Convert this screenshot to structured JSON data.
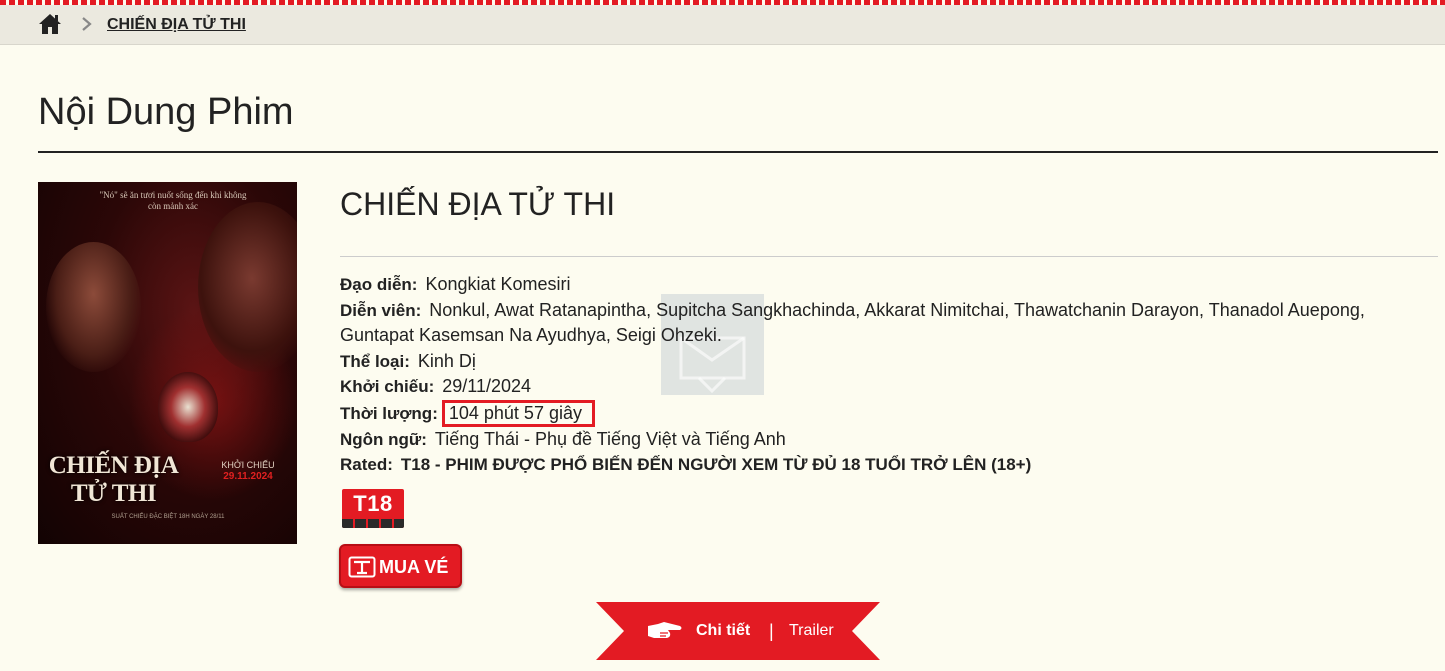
{
  "breadcrumb": {
    "current": "CHIẾN ĐỊA TỬ THI"
  },
  "page": {
    "title": "Nội Dung Phim"
  },
  "poster": {
    "tagline": "\"Nó\" sẽ ăn tươi nuốt sống đến khi không còn mảnh xác",
    "title_line1": "CHIẾN ĐỊA",
    "title_line2": "TỬ THI",
    "release_label": "KHỞI CHIẾU",
    "release_date": "29.11.2024",
    "credits": "SUẤT CHIẾU ĐẶC BIỆT 18H NGÀY 28/11"
  },
  "movie": {
    "title": "CHIẾN ĐỊA TỬ THI",
    "director_label": "Đạo diễn:",
    "director": "Kongkiat Komesiri",
    "cast_label": "Diễn viên:",
    "cast": "Nonkul, Awat Ratanapintha, Supitcha Sangkhachinda, Akkarat Nimitchai, Thawatchanin Darayon, Thanadol Auepong, Guntapat Kasemsan Na Ayudhya, Seigi Ohzeki.",
    "genre_label": "Thể loại:",
    "genre": "Kinh Dị",
    "release_label": "Khởi chiếu:",
    "release": "29/11/2024",
    "duration_label": "Thời lượng:",
    "duration": "104 phút 57 giây",
    "language_label": "Ngôn ngữ:",
    "language": "Tiếng Thái - Phụ đề Tiếng Việt và Tiếng Anh",
    "rated_label": "Rated:",
    "rated": "T18 - PHIM ĐƯỢC PHỔ BIẾN ĐẾN NGƯỜI XEM TỪ ĐỦ 18 TUỔI TRỞ LÊN (18+)",
    "rating_badge": "T18"
  },
  "actions": {
    "buy_label": "MUA VÉ"
  },
  "tabs": {
    "detail": "Chi tiết",
    "separator": "|",
    "trailer": "Trailer"
  },
  "colors": {
    "accent": "#e31b23",
    "background": "#fdfcf0",
    "breadcrumb_bg": "#ebe9df"
  },
  "icons": {
    "home": "home-icon",
    "chevron": "chevron-right-icon",
    "ticket": "ticket-icon",
    "hand": "pointing-hand-icon"
  }
}
